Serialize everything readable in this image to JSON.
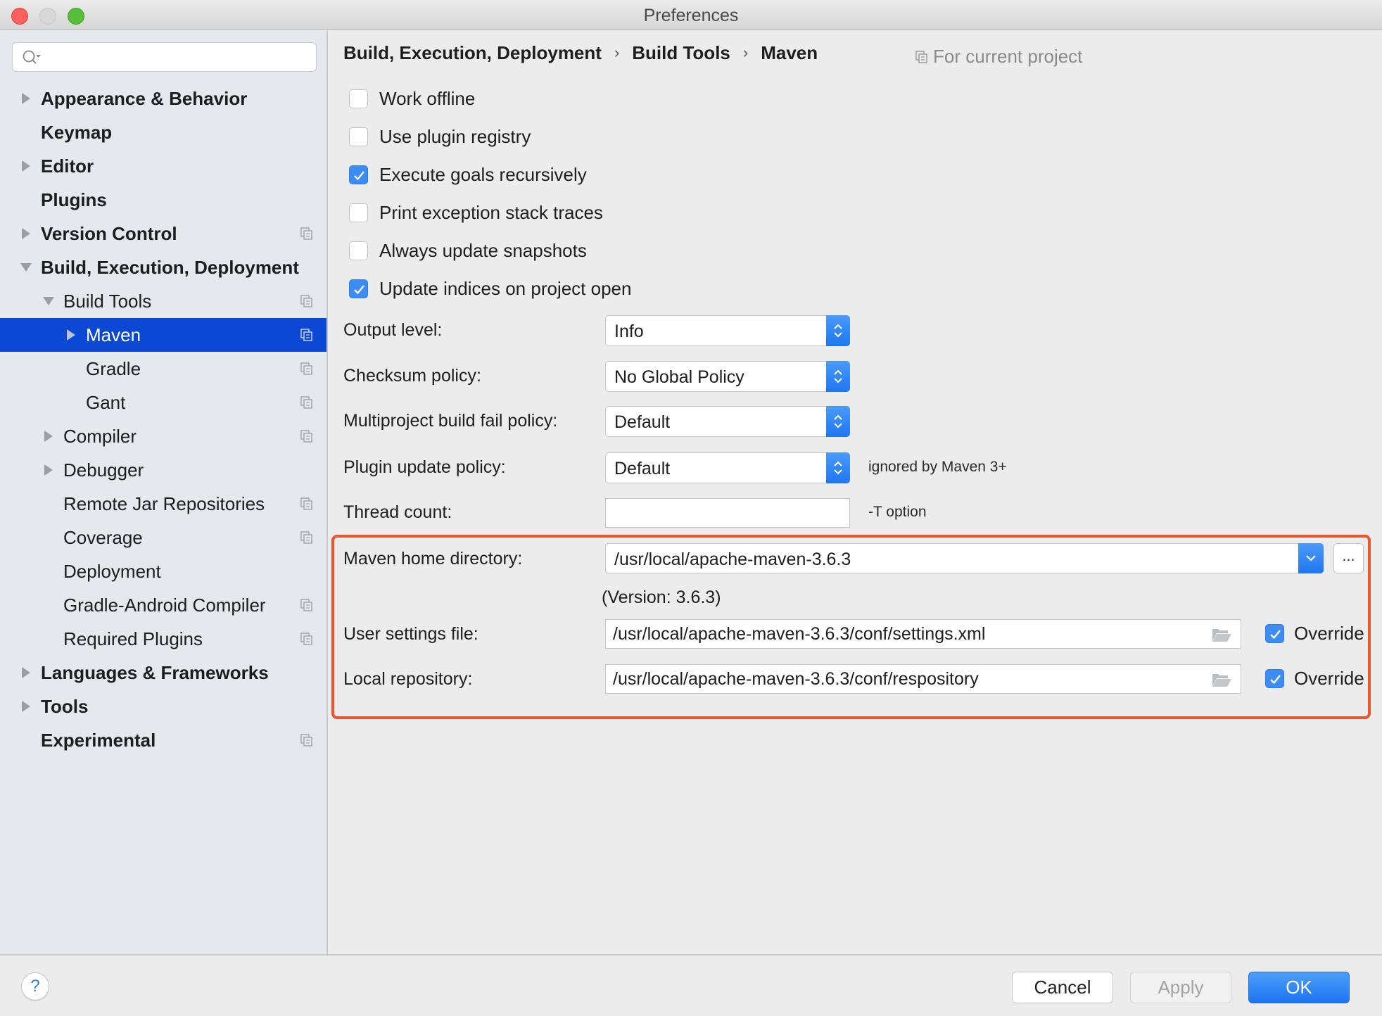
{
  "window": {
    "title": "Preferences"
  },
  "sidebar": {
    "search": {
      "placeholder": "",
      "value": ""
    },
    "items": [
      {
        "label": "Appearance & Behavior",
        "level": 0,
        "bold": true,
        "arrow": "collapsed",
        "project_icon": false
      },
      {
        "label": "Keymap",
        "level": 0,
        "bold": true,
        "arrow": "none",
        "project_icon": false
      },
      {
        "label": "Editor",
        "level": 0,
        "bold": true,
        "arrow": "collapsed",
        "project_icon": false
      },
      {
        "label": "Plugins",
        "level": 0,
        "bold": true,
        "arrow": "none",
        "project_icon": false
      },
      {
        "label": "Version Control",
        "level": 0,
        "bold": true,
        "arrow": "collapsed",
        "project_icon": true
      },
      {
        "label": "Build, Execution, Deployment",
        "level": 0,
        "bold": true,
        "arrow": "expanded",
        "project_icon": false
      },
      {
        "label": "Build Tools",
        "level": 1,
        "bold": false,
        "arrow": "expanded",
        "project_icon": true
      },
      {
        "label": "Maven",
        "level": 2,
        "bold": false,
        "arrow": "collapsed",
        "project_icon": true,
        "selected": true
      },
      {
        "label": "Gradle",
        "level": 2,
        "bold": false,
        "arrow": "none",
        "project_icon": true
      },
      {
        "label": "Gant",
        "level": 2,
        "bold": false,
        "arrow": "none",
        "project_icon": true
      },
      {
        "label": "Compiler",
        "level": 1,
        "bold": false,
        "arrow": "collapsed",
        "project_icon": true
      },
      {
        "label": "Debugger",
        "level": 1,
        "bold": false,
        "arrow": "collapsed",
        "project_icon": false
      },
      {
        "label": "Remote Jar Repositories",
        "level": 1,
        "bold": false,
        "arrow": "none",
        "project_icon": true
      },
      {
        "label": "Coverage",
        "level": 1,
        "bold": false,
        "arrow": "none",
        "project_icon": true
      },
      {
        "label": "Deployment",
        "level": 1,
        "bold": false,
        "arrow": "none",
        "project_icon": false
      },
      {
        "label": "Gradle-Android Compiler",
        "level": 1,
        "bold": false,
        "arrow": "none",
        "project_icon": true
      },
      {
        "label": "Required Plugins",
        "level": 1,
        "bold": false,
        "arrow": "none",
        "project_icon": true
      },
      {
        "label": "Languages & Frameworks",
        "level": 0,
        "bold": true,
        "arrow": "collapsed",
        "project_icon": false
      },
      {
        "label": "Tools",
        "level": 0,
        "bold": true,
        "arrow": "collapsed",
        "project_icon": false
      },
      {
        "label": "Experimental",
        "level": 0,
        "bold": true,
        "arrow": "none",
        "project_icon": true
      }
    ]
  },
  "breadcrumb": {
    "items": [
      "Build, Execution, Deployment",
      "Build Tools",
      "Maven"
    ],
    "separator": "›",
    "scope_label": "For current project"
  },
  "options": {
    "checkboxes": [
      {
        "label": "Work offline",
        "checked": false
      },
      {
        "label": "Use plugin registry",
        "checked": false
      },
      {
        "label": "Execute goals recursively",
        "checked": true
      },
      {
        "label": "Print exception stack traces",
        "checked": false
      },
      {
        "label": "Always update snapshots",
        "checked": false
      },
      {
        "label": "Update indices on project open",
        "checked": true
      }
    ],
    "output_level": {
      "label": "Output level:",
      "value": "Info"
    },
    "checksum_policy": {
      "label": "Checksum policy:",
      "value": "No Global Policy"
    },
    "multiproject_fail_policy": {
      "label": "Multiproject build fail policy:",
      "value": "Default"
    },
    "plugin_update_policy": {
      "label": "Plugin update policy:",
      "value": "Default",
      "hint": "ignored by Maven 3+"
    },
    "thread_count": {
      "label": "Thread count:",
      "value": "",
      "hint": "-T option"
    },
    "maven_home": {
      "label": "Maven home directory:",
      "value": "/usr/local/apache-maven-3.6.3",
      "browse_label": "...",
      "version_text": "(Version: 3.6.3)"
    },
    "user_settings": {
      "label": "User settings file:",
      "value": "/usr/local/apache-maven-3.6.3/conf/settings.xml",
      "override_label": "Override",
      "override_checked": true
    },
    "local_repository": {
      "label": "Local repository:",
      "value": "/usr/local/apache-maven-3.6.3/conf/respository",
      "override_label": "Override",
      "override_checked": true
    }
  },
  "footer": {
    "help_label": "?",
    "cancel_label": "Cancel",
    "apply_label": "Apply",
    "ok_label": "OK"
  },
  "colors": {
    "selection": "#0b49d4",
    "accent": "#2f7ee8",
    "highlight_border": "#e8552f"
  }
}
